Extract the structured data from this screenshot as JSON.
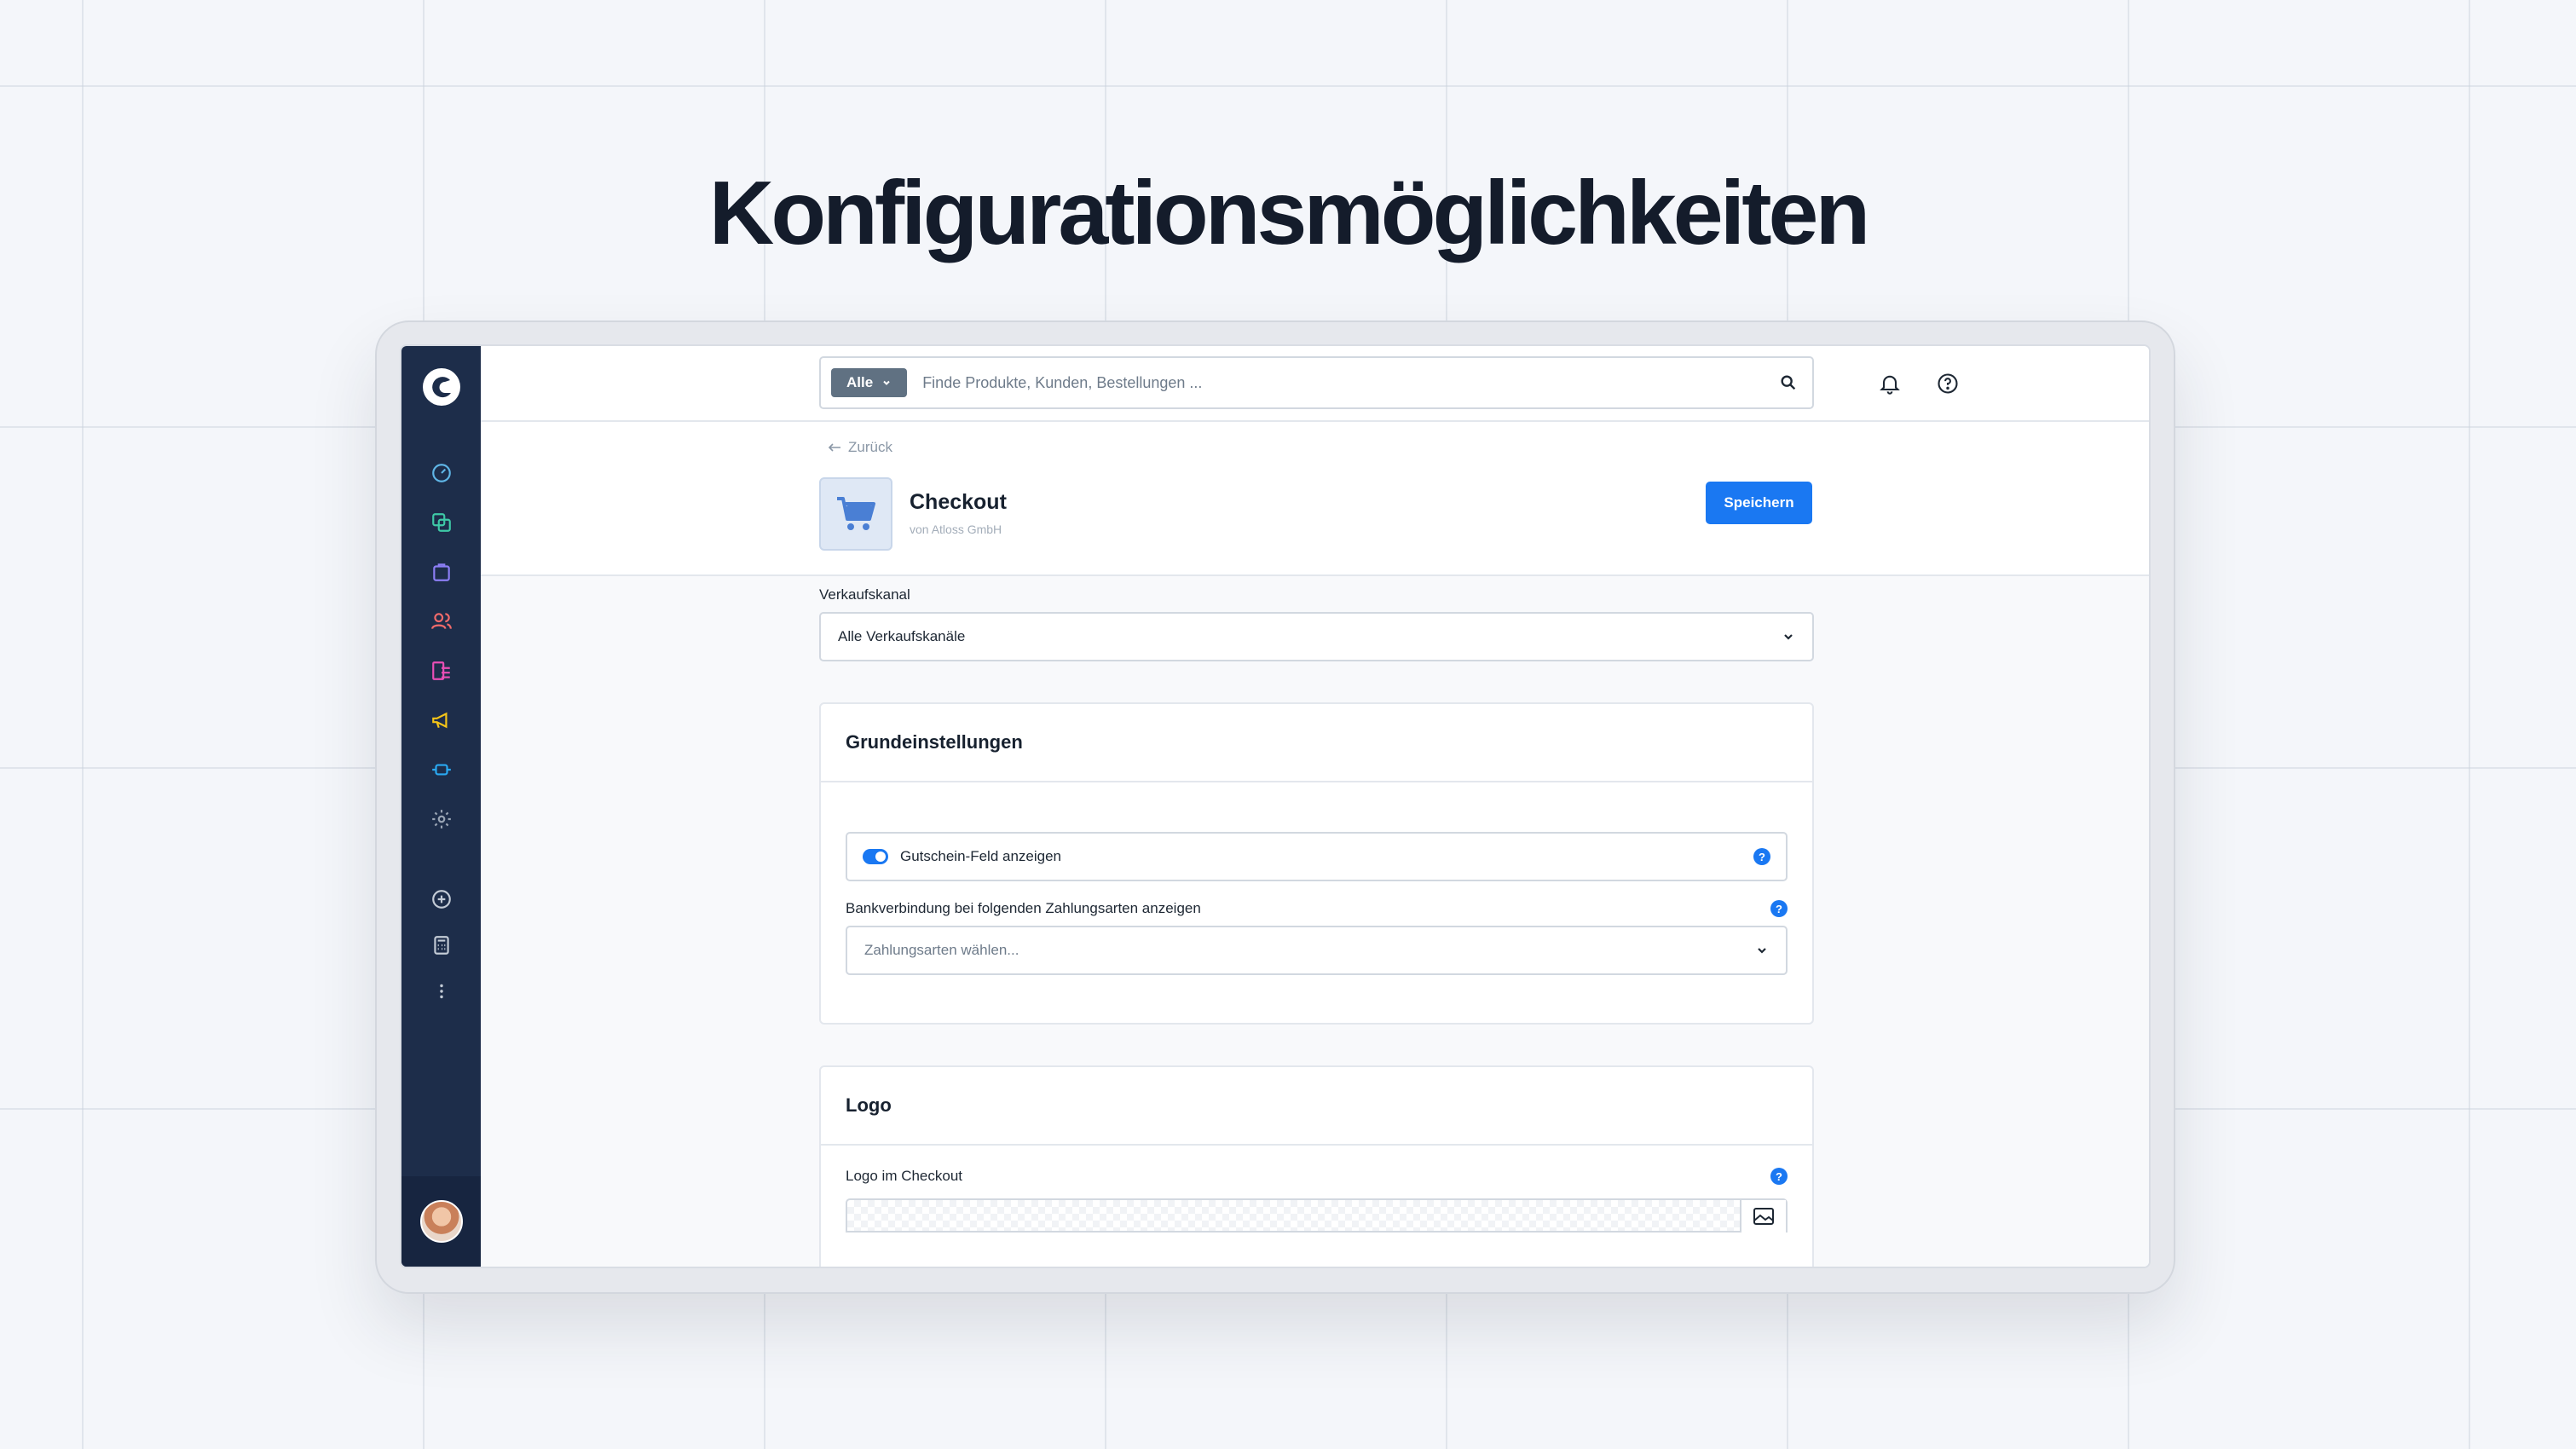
{
  "hero": {
    "title": "Konfigurationsmöglichkeiten"
  },
  "search": {
    "type_label": "Alle",
    "placeholder": "Finde Produkte, Kunden, Bestellungen ..."
  },
  "header": {
    "back_label": "Zurück",
    "app_name": "Checkout",
    "vendor": "von Atloss GmbH",
    "save_label": "Speichern"
  },
  "sales_channel": {
    "label": "Verkaufskanal",
    "value": "Alle Verkaufskanäle"
  },
  "basic_settings": {
    "title": "Grundeinstellungen",
    "voucher_toggle_label": "Gutschein-Feld anzeigen",
    "voucher_toggle_on": true,
    "bank_label": "Bankverbindung bei folgenden Zahlungsarten anzeigen",
    "payment_placeholder": "Zahlungsarten wählen..."
  },
  "logo_settings": {
    "title": "Logo",
    "checkout_logo_label": "Logo im Checkout"
  },
  "help_glyph": "?",
  "sidebar": {
    "items": [
      "dashboard-icon",
      "catalog-icon",
      "orders-icon",
      "customers-icon",
      "content-icon",
      "marketing-icon",
      "extensions-icon",
      "settings-icon"
    ],
    "extra": [
      "add-circle-icon",
      "calculator-icon",
      "more-icon"
    ]
  },
  "colors": {
    "accent": "#1a78f2",
    "sidebar": "#1d2d4a"
  }
}
